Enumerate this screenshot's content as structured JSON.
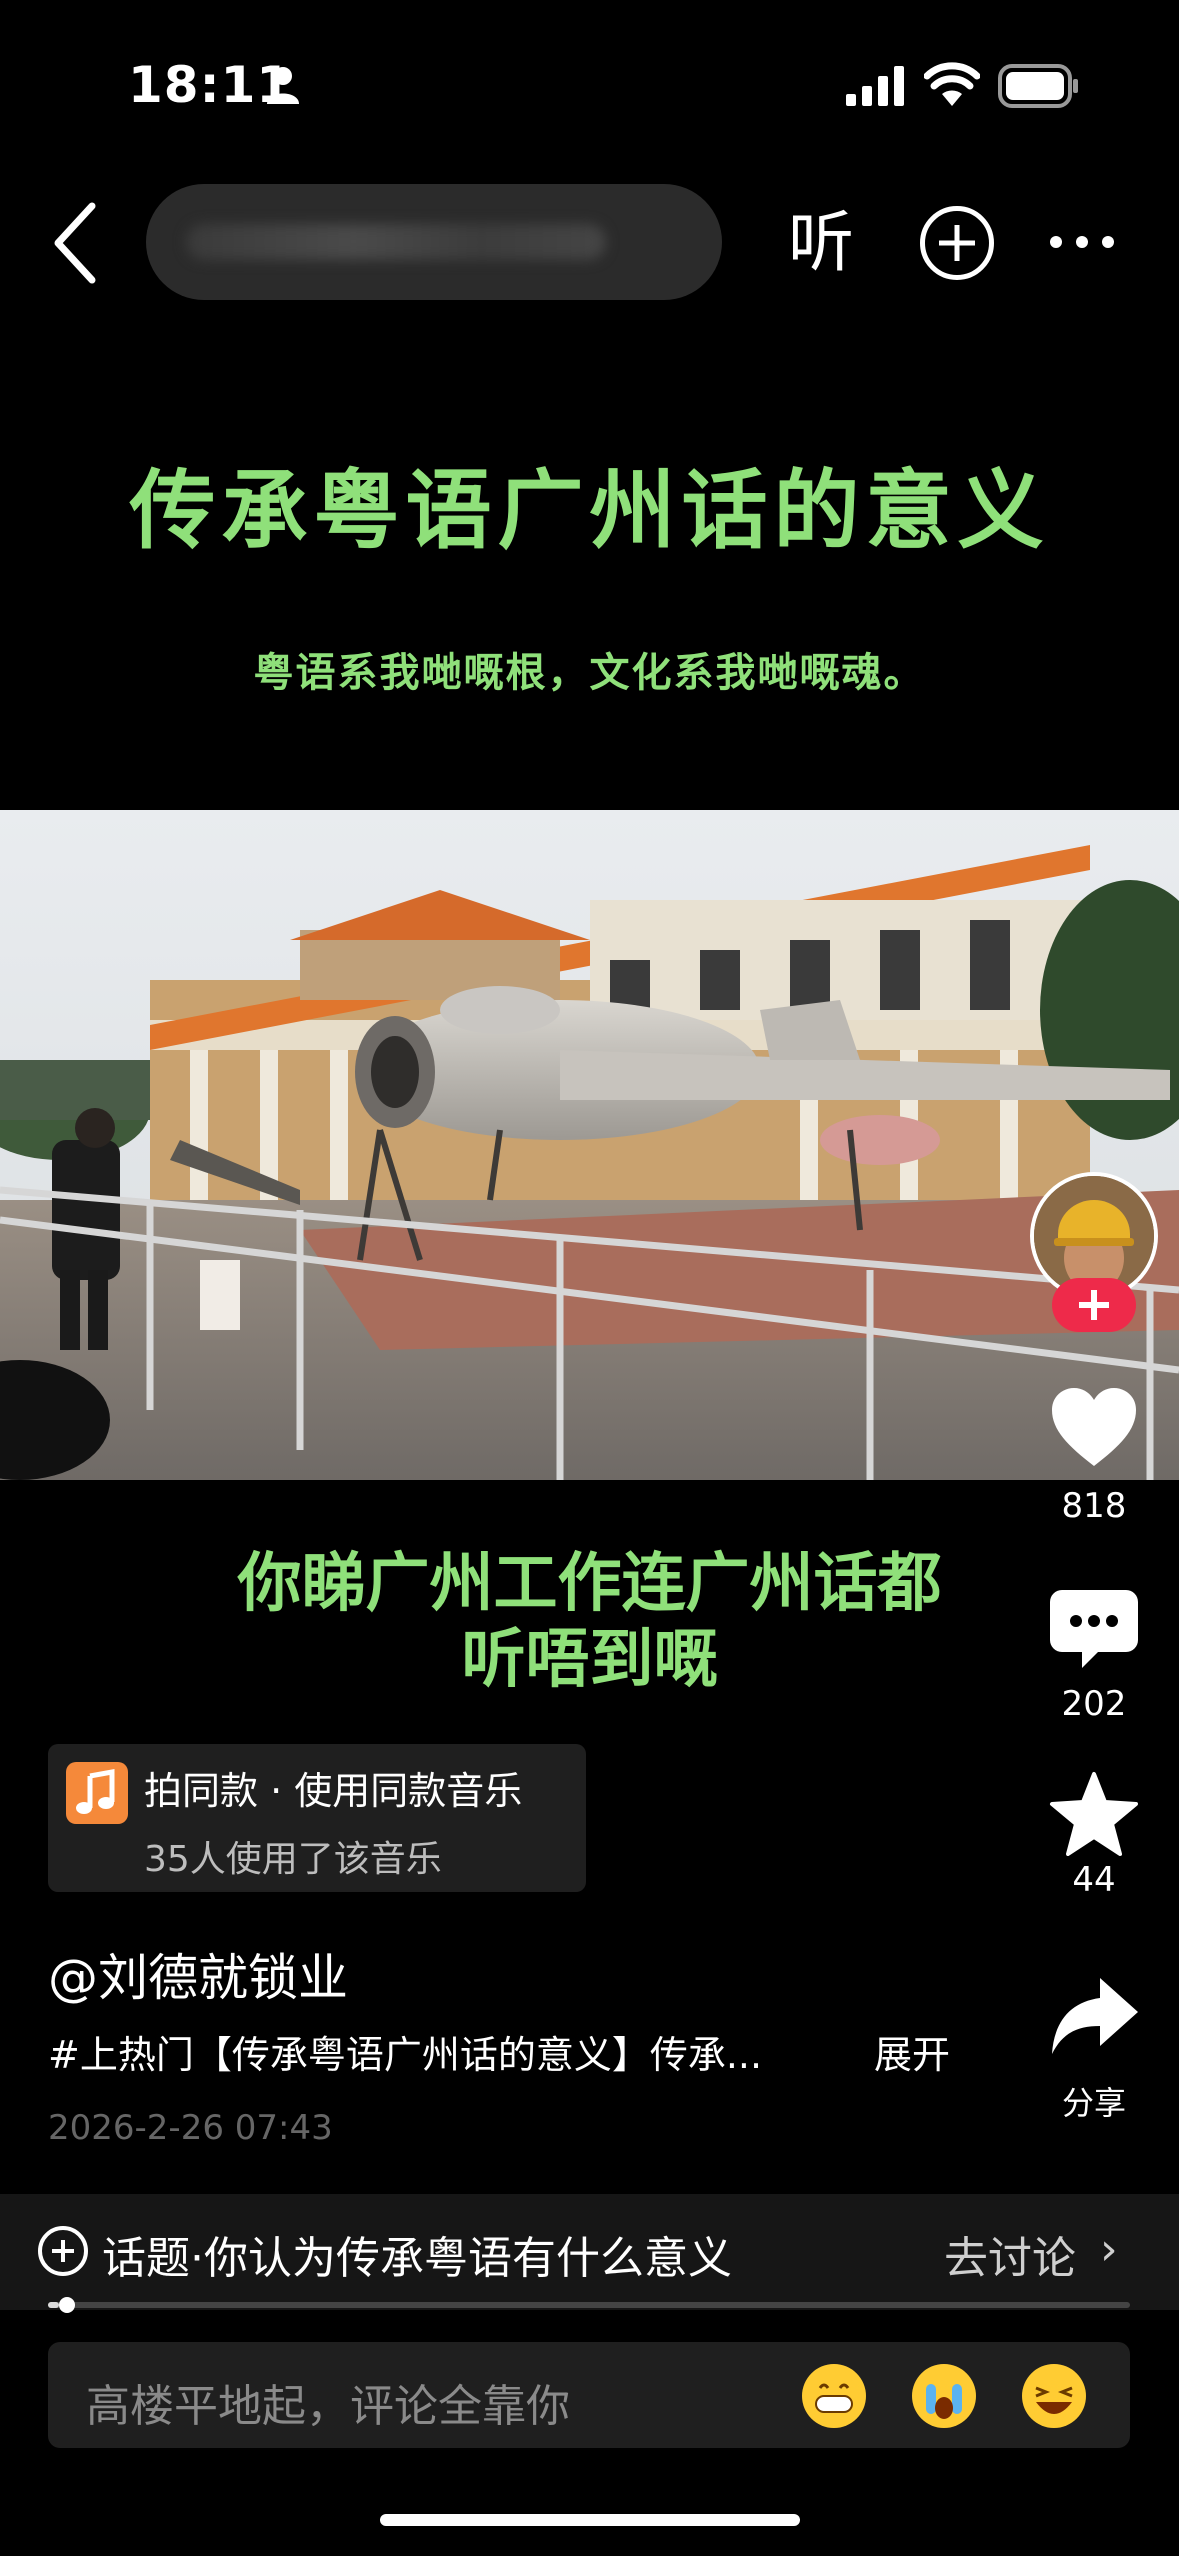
{
  "status_bar": {
    "time": "18:11"
  },
  "nav": {
    "listen_label": "听"
  },
  "video": {
    "title": "传承粤语广州话的意义",
    "subtitle": "粤语系我哋嘅根，文化系我哋嘅魂。",
    "caption_line1": "你睇广州工作连广州话都",
    "caption_line2": "听唔到嘅"
  },
  "rail": {
    "likes": "818",
    "comments": "202",
    "favorites": "44",
    "share_label": "分享"
  },
  "music": {
    "title": "拍同款 · 使用同款音乐",
    "users": "35人使用了该音乐"
  },
  "post": {
    "author": "@刘德就锁业",
    "description": "#上热门【传承粤语广州话的意义】传承...",
    "expand_label": "展开",
    "date": "2026-2-26 07:43"
  },
  "topic": {
    "text": "话题·你认为传承粤语有什么意义",
    "action": "去讨论"
  },
  "progress": {
    "fraction": 0.01
  },
  "comment": {
    "placeholder": "高楼平地起，评论全靠你"
  },
  "icons": [
    "person-icon",
    "signal-icon",
    "wifi-icon",
    "battery-icon",
    "back-icon",
    "add-icon",
    "more-icon",
    "heart-icon",
    "comment-icon",
    "star-icon",
    "share-icon",
    "music-note-icon",
    "topic-add-icon",
    "chevron-right-icon",
    "grin-emoji-icon",
    "crying-emoji-icon",
    "laughing-emoji-icon"
  ],
  "colors": {
    "accent_green": "#8fe07a",
    "follow_red": "#ee2a4a",
    "music_orange": "#f5893a"
  }
}
